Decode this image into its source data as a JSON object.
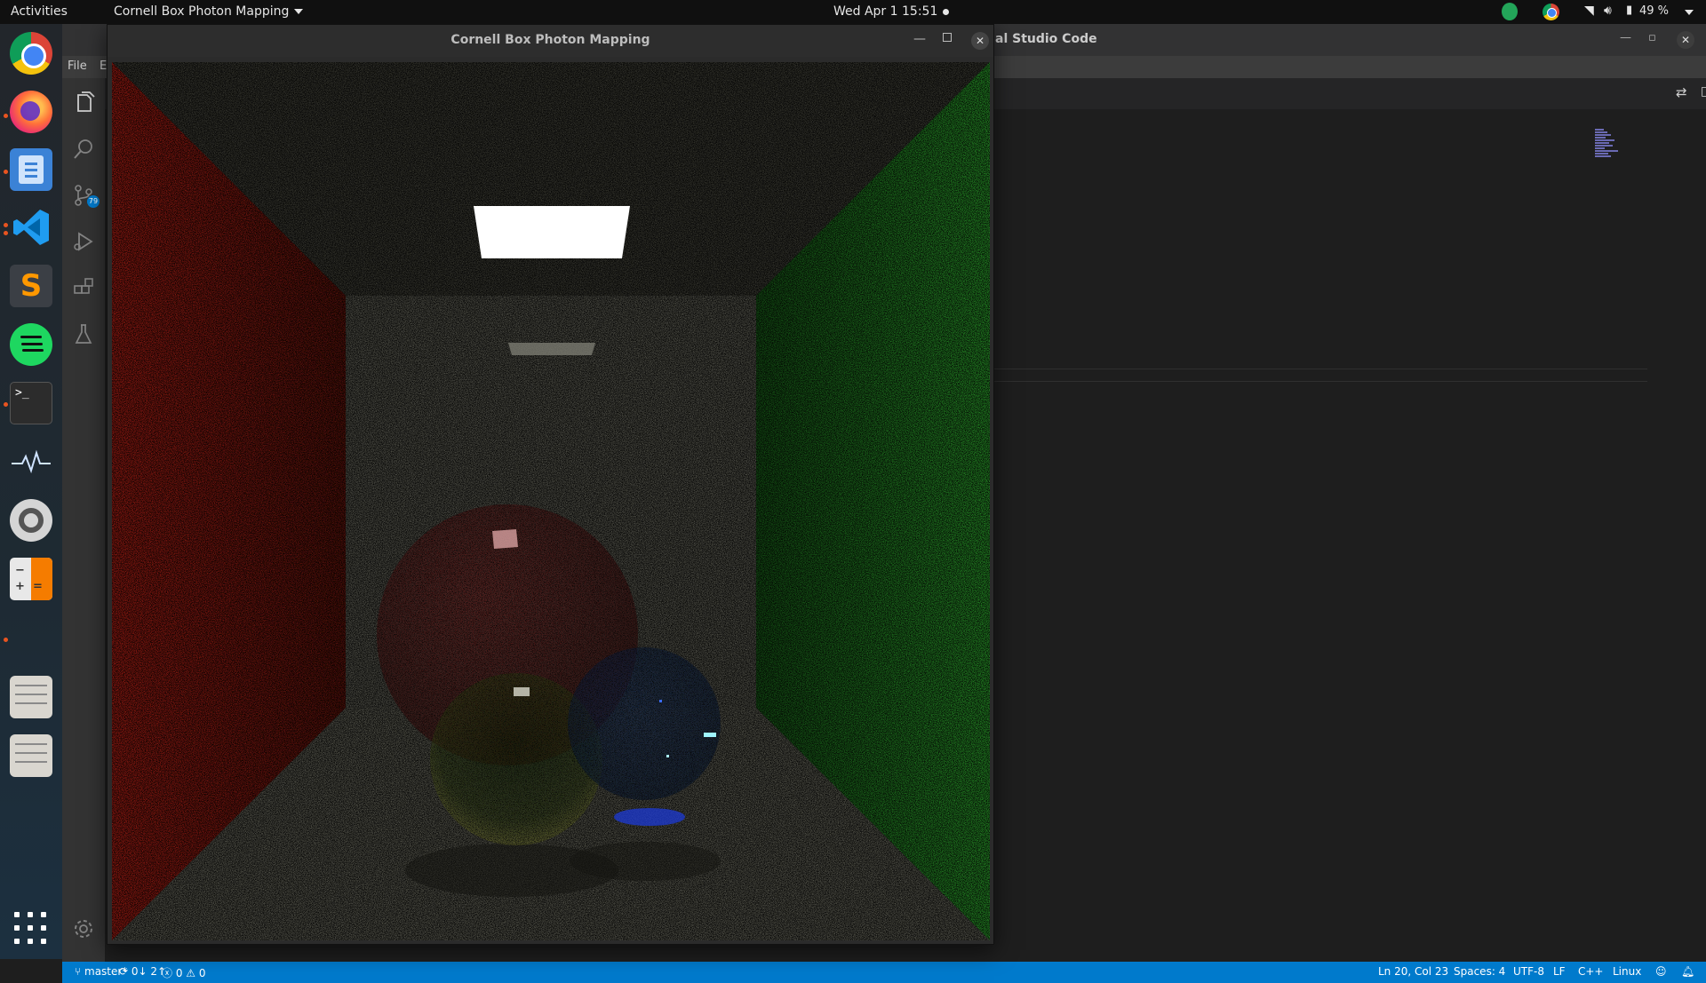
{
  "topbar": {
    "activities": "Activities",
    "app_menu": "Cornell Box Photon Mapping",
    "clock": "Wed Apr 1  15:51",
    "battery": "49 %"
  },
  "dock": {
    "items": [
      "chrome",
      "firefox",
      "files",
      "vscode",
      "sublime-text",
      "spotify",
      "terminal",
      "system-monitor",
      "settings",
      "calculator",
      "drive-1",
      "drive-2"
    ]
  },
  "vscode": {
    "title": "al Studio Code",
    "menu": {
      "file": "File",
      "edit": "E"
    },
    "scm_badge": "79",
    "status": {
      "branch": "master*",
      "sync": "0↓ 2↑",
      "problems": "0",
      "warnings": "0",
      "position": "Ln 20, Col 23",
      "spaces": "Spaces: 4",
      "encoding": "UTF-8",
      "eol": "LF",
      "language": "C++",
      "os": "Linux"
    }
  },
  "render_window": {
    "title": "Cornell Box Photon Mapping"
  },
  "colors": {
    "vscode_accent": "#007acc",
    "left_wall": "#8a1a12",
    "right_wall": "#1d7a1d",
    "light": "#ffffff"
  }
}
